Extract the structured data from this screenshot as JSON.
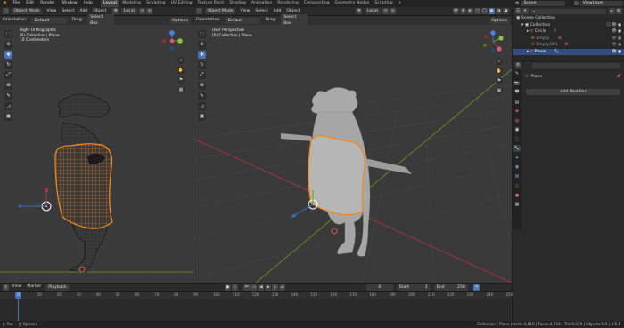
{
  "topbar": {
    "menus": [
      "File",
      "Edit",
      "Render",
      "Window",
      "Help"
    ],
    "workspaces": [
      {
        "label": "Layout",
        "active": true
      },
      {
        "label": "Modeling"
      },
      {
        "label": "Sculpting"
      },
      {
        "label": "UV Editing"
      },
      {
        "label": "Texture Paint"
      },
      {
        "label": "Shading"
      },
      {
        "label": "Animation"
      },
      {
        "label": "Rendering"
      },
      {
        "label": "Compositing"
      },
      {
        "label": "Geometry Nodes"
      },
      {
        "label": "Scripting"
      }
    ],
    "add_tab": "+",
    "scene": "Scene",
    "view_layer": "ViewLayer"
  },
  "left_view": {
    "mode": "Object Mode",
    "menus": [
      "View",
      "Select",
      "Add",
      "Object"
    ],
    "transform_orientation": "Local",
    "orientation_label": "Orientation:",
    "orientation_value": "Default",
    "drag_label": "Drag:",
    "drag_value": "Select Box",
    "options": "Options",
    "overlay": [
      "Right Orthographic",
      "(0) Collection | Plane",
      "10 Centimeters"
    ]
  },
  "right_view": {
    "mode": "Object Mode",
    "menus": [
      "View",
      "Select",
      "Add",
      "Object"
    ],
    "transform_orientation": "Local",
    "orientation_label": "Orientation:",
    "orientation_value": "Default",
    "drag_label": "Drag:",
    "drag_value": "Select Box",
    "options": "Options",
    "overlay": [
      "User Perspective",
      "(0) Collection | Plane"
    ]
  },
  "outliner": {
    "search_placeholder": "",
    "root": "Scene Collection",
    "items": [
      {
        "label": "Collection",
        "indent": 1
      },
      {
        "label": "Circle",
        "indent": 2
      },
      {
        "label": "Empty",
        "indent": 2
      },
      {
        "label": "Empty.001",
        "indent": 2
      },
      {
        "label": "Plane",
        "indent": 2,
        "selected": true
      }
    ]
  },
  "properties": {
    "object_name": "Plane",
    "add_modifier": "Add Modifier"
  },
  "timeline": {
    "menus": [
      "View",
      "Marker",
      "Playback"
    ],
    "current_frame": "0",
    "start_label": "Start",
    "start_value": "1",
    "end_label": "End",
    "end_value": "250",
    "ruler": [
      "0",
      "10",
      "20",
      "30",
      "40",
      "50",
      "60",
      "70",
      "80",
      "90",
      "100",
      "110",
      "120",
      "130",
      "140",
      "150",
      "160",
      "170",
      "180",
      "190",
      "200",
      "210",
      "220",
      "230",
      "240",
      "250"
    ],
    "playhead": "0"
  },
  "status": {
    "left": [
      "Pan",
      "Options"
    ],
    "right": "Collection | Plane | Verts:4,816 | Faces:4,744 | Tris:9,039 | Objects:1/3 | 3.6.1"
  },
  "colors": {
    "accent": "#4772b3",
    "selected_object": "#f28a1b",
    "axis_x": "#b3323e",
    "axis_y": "#6a9a1f",
    "axis_z": "#3a6fbf"
  }
}
